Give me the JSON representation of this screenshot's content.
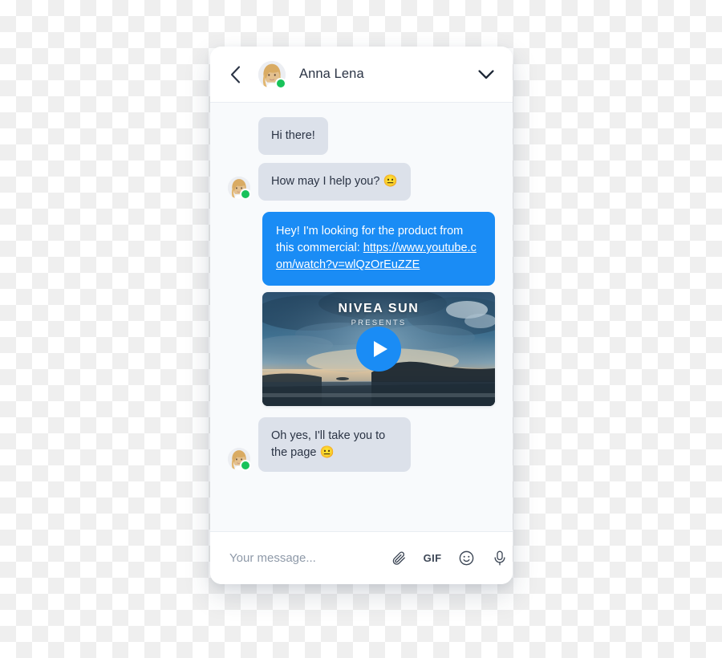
{
  "header": {
    "back_icon": "chevron-left-icon",
    "contact_name": "Anna Lena",
    "avatar_alt": "Anna Lena avatar",
    "status": "online",
    "status_color": "#18c25a",
    "menu_icon": "chevron-down-icon"
  },
  "theme": {
    "outgoing_bubble_color": "#1a8cf5",
    "incoming_bubble_color": "#dce1ea",
    "incoming_text_color": "#2b3445",
    "outgoing_text_color": "#ffffff",
    "card_background": "#ffffff",
    "body_background": "#f8fafc"
  },
  "messages": [
    {
      "id": "msg-1",
      "direction": "incoming",
      "text": "Hi there!",
      "has_avatar": false
    },
    {
      "id": "msg-2",
      "direction": "incoming",
      "text": "How may I help you? ",
      "emoji": "😐",
      "has_avatar": true
    },
    {
      "id": "msg-3",
      "direction": "outgoing",
      "text": "Hey! I'm looking for the product from this commercial: ",
      "link": "https://www.youtube.com/watch?v=wlQzOrEuZZE",
      "has_avatar": false
    },
    {
      "id": "msg-4",
      "direction": "incoming",
      "text": "Oh yes, I'll take you to the page ",
      "emoji": "😐",
      "has_avatar": true
    }
  ],
  "video": {
    "title": "NIVEA SUN",
    "subtitle": "PRESENTS",
    "play_icon": "play-icon",
    "play_button_color": "#1a8cf5",
    "scene": "sunset over ocean with clouds and headland"
  },
  "composer": {
    "placeholder": "Your message...",
    "value": "",
    "actions": [
      {
        "name": "attach-icon",
        "label": ""
      },
      {
        "name": "gif-icon",
        "label": "GIF"
      },
      {
        "name": "emoji-icon",
        "label": ""
      },
      {
        "name": "microphone-icon",
        "label": ""
      }
    ]
  }
}
